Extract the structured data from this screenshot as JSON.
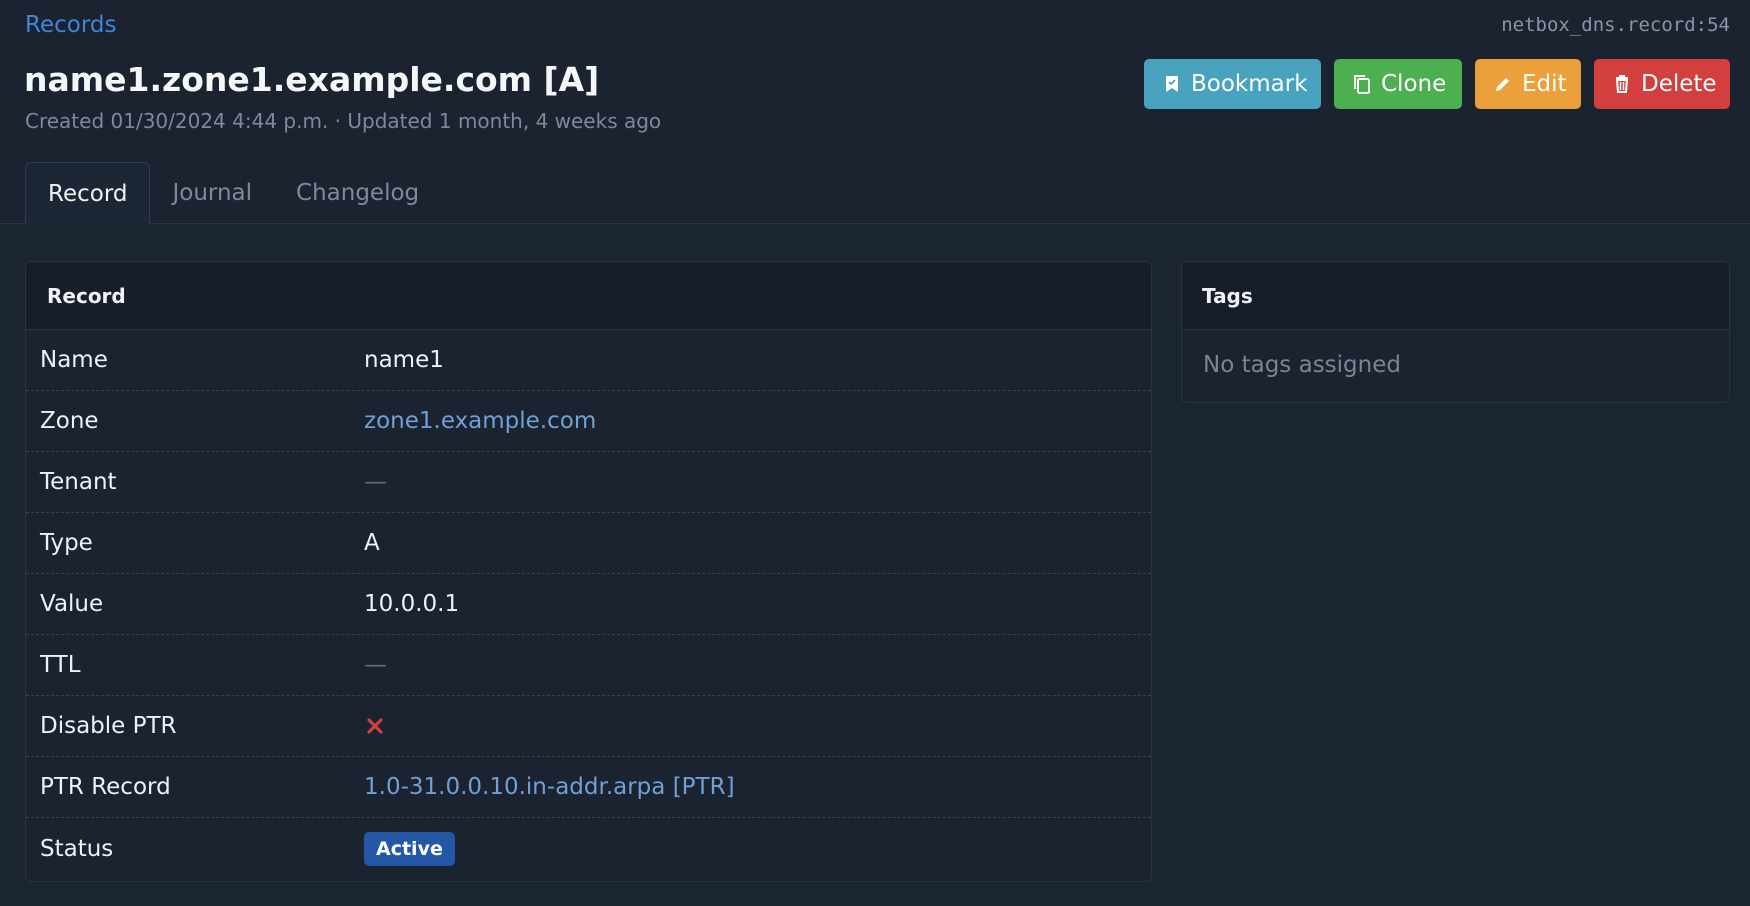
{
  "breadcrumb": {
    "label": "Records"
  },
  "object_id": "netbox_dns.record:54",
  "title": "name1.zone1.example.com [A]",
  "meta": "Created 01/30/2024 4:44 p.m. · Updated 1 month, 4 weeks ago",
  "actions": {
    "bookmark": "Bookmark",
    "clone": "Clone",
    "edit": "Edit",
    "delete": "Delete"
  },
  "tabs": [
    {
      "label": "Record",
      "active": true
    },
    {
      "label": "Journal",
      "active": false
    },
    {
      "label": "Changelog",
      "active": false
    }
  ],
  "record_card": {
    "title": "Record",
    "rows": [
      {
        "label": "Name",
        "value": "name1"
      },
      {
        "label": "Zone",
        "value": "zone1.example.com"
      },
      {
        "label": "Tenant",
        "value": "—"
      },
      {
        "label": "Type",
        "value": "A"
      },
      {
        "label": "Value",
        "value": "10.0.0.1"
      },
      {
        "label": "TTL",
        "value": "—"
      },
      {
        "label": "Disable PTR",
        "icon": "x-icon"
      },
      {
        "label": "PTR Record",
        "value": "1.0-31.0.0.10.in-addr.arpa [PTR]"
      },
      {
        "label": "Status",
        "value": "Active"
      }
    ]
  },
  "tags_card": {
    "title": "Tags",
    "empty_text": "No tags assigned"
  },
  "colors": {
    "link": "#3f86d6",
    "bookmark": "#4aa3be",
    "clone": "#4caf50",
    "edit": "#eca03c",
    "delete": "#d33f3f",
    "status_active": "#2458a6",
    "false_icon": "#d33f3f"
  },
  "icons": {
    "bookmark": "bookmark-icon",
    "clone": "clone-icon",
    "edit": "pencil-icon",
    "delete": "trash-icon",
    "disable_ptr": "x-icon"
  }
}
